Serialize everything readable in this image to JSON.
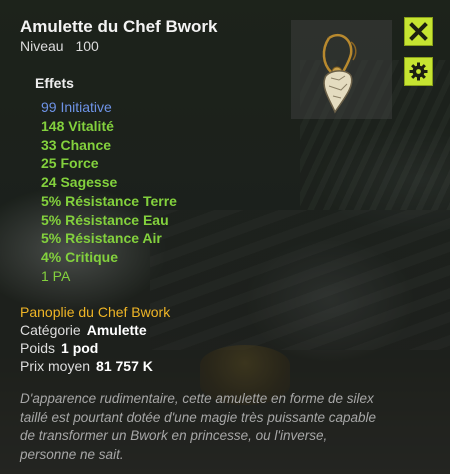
{
  "item": {
    "name": "Amulette du Chef Bwork",
    "level_label": "Niveau",
    "level_value": "100"
  },
  "effects_title": "Effets",
  "effects": [
    "99 Initiative",
    "148 Vitalité",
    "33 Chance",
    "25 Force",
    "24 Sagesse",
    "5% Résistance Terre",
    "5% Résistance Eau",
    "5% Résistance Air",
    "4% Critique",
    "1 PA"
  ],
  "set_name": "Panoplie du Chef Bwork",
  "info": {
    "category_label": "Catégorie",
    "category_value": "Amulette",
    "weight_label": "Poids",
    "weight_value": "1 pod",
    "price_label": "Prix moyen",
    "price_value": "81 757 K"
  },
  "description": "D'apparence rudimentaire, cette amulette en forme de silex taillé est pourtant dotée d'une magie très puissante capable de transformer un Bwork en princesse, ou l'inverse, personne ne sait.",
  "icons": {
    "close": "close-x-icon",
    "settings": "gear-icon",
    "item": "amulet-icon"
  },
  "colors": {
    "accent": "#c6e431",
    "effect_green": "#83d13d",
    "effect_blue": "#6e93e6",
    "set_gold": "#efb526",
    "description": "#a7a7a7"
  }
}
